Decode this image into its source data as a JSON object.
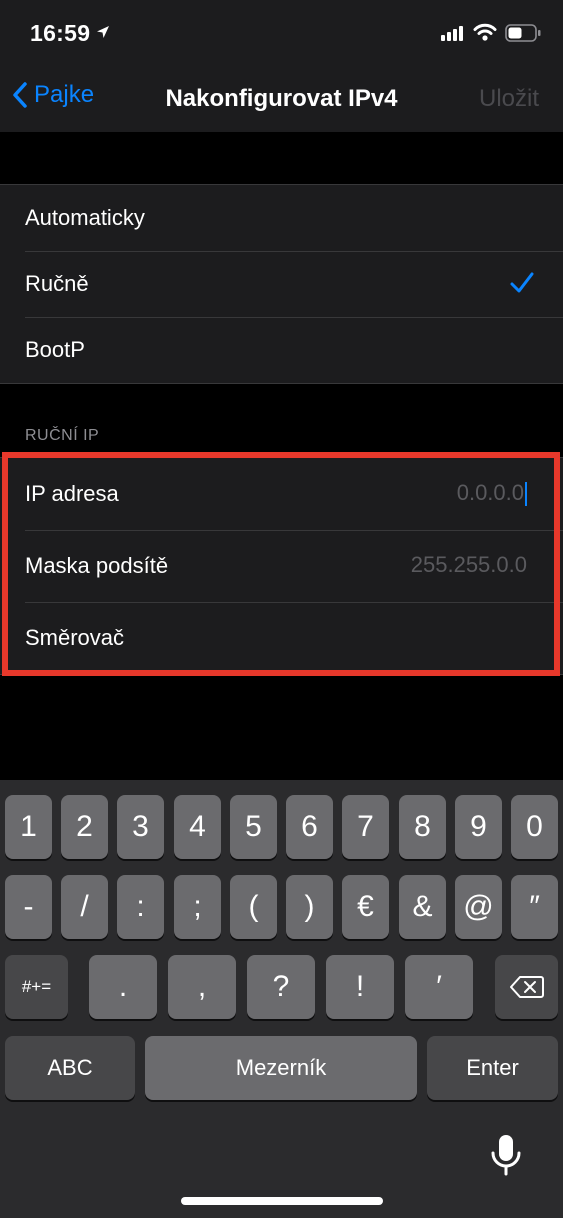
{
  "status_bar": {
    "time": "16:59"
  },
  "nav": {
    "back_label": "Pajke",
    "title": "Nakonfigurovat IPv4",
    "save_label": "Uložit"
  },
  "options": [
    {
      "label": "Automaticky",
      "selected": false
    },
    {
      "label": "Ručně",
      "selected": true
    },
    {
      "label": "BootP",
      "selected": false
    }
  ],
  "manual_ip": {
    "header": "RUČNÍ IP",
    "fields": [
      {
        "label": "IP adresa",
        "placeholder": "0.0.0.0"
      },
      {
        "label": "Maska podsítě",
        "placeholder": "255.255.0.0"
      },
      {
        "label": "Směrovač",
        "placeholder": ""
      }
    ]
  },
  "keyboard": {
    "row1": [
      "1",
      "2",
      "3",
      "4",
      "5",
      "6",
      "7",
      "8",
      "9",
      "0"
    ],
    "row2": [
      "-",
      "/",
      ":",
      ";",
      "(",
      ")",
      "€",
      "&",
      "@",
      "″"
    ],
    "row3": [
      "#+=",
      ".",
      ",",
      "?",
      "!",
      "′"
    ],
    "abc_label": "ABC",
    "space_label": "Mezerník",
    "enter_label": "Enter"
  },
  "colors": {
    "accent": "#0a84ff",
    "highlight_border": "#e7382b",
    "cell_bg": "#1c1c1e"
  }
}
